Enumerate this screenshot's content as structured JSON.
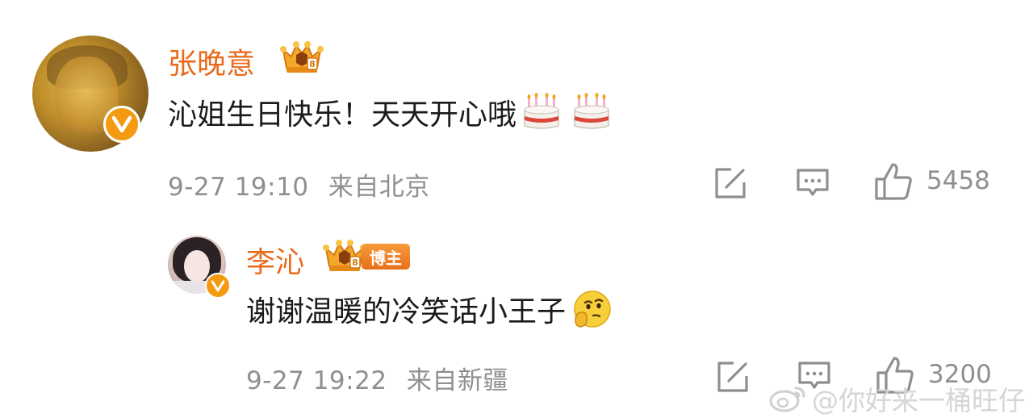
{
  "comment": {
    "username": "张晚意",
    "content": "沁姐生日快乐！天天开心哦",
    "emojis": [
      "birthday-cake",
      "birthday-cake"
    ],
    "date": "9-27 19:10",
    "location": "来自北京",
    "like_count": "5458"
  },
  "reply": {
    "username": "李沁",
    "role_badge": "博主",
    "content": "谢谢温暖的冷笑话小王子",
    "emojis": [
      "thinking-face"
    ],
    "date": "9-27 19:22",
    "location": "来自新疆",
    "like_count": "3200"
  },
  "watermark": {
    "text": "@你好来一桶旺仔"
  },
  "colors": {
    "username": "#ea6a1b",
    "badge_orange": "#f39a11",
    "meta_gray": "#8f8f8f"
  }
}
